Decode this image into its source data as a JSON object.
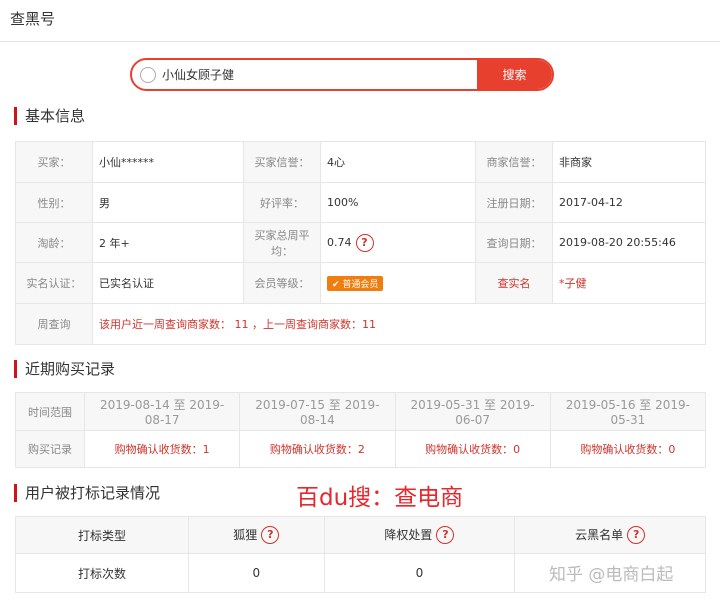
{
  "header": {
    "title": "查黑号"
  },
  "search": {
    "value": "小仙女顾子健",
    "button": "搜索"
  },
  "basic": {
    "title": "基本信息",
    "rows": [
      [
        {
          "l": "买家：",
          "v": "小仙******"
        },
        {
          "l": "买家信誉：",
          "v": "4心"
        },
        {
          "l": "商家信誉：",
          "v": "非商家"
        }
      ],
      [
        {
          "l": "性别：",
          "v": "男"
        },
        {
          "l": "好评率：",
          "v": "100%"
        },
        {
          "l": "注册日期：",
          "v": "2017-04-12"
        }
      ],
      [
        {
          "l": "淘龄：",
          "v": "2 年+"
        },
        {
          "l": "买家总周平均：",
          "v": "0.74"
        },
        {
          "l": "查询日期：",
          "v": "2019-08-20 20:55:46"
        }
      ],
      [
        {
          "l": "实名认证：",
          "v": "已实名认证"
        },
        {
          "l": "会员等级：",
          "v": "普通会员"
        },
        {
          "l": "查实名",
          "v": "*子健"
        }
      ]
    ],
    "weekly_label": "周查询",
    "weekly_value": "该用户近一周查询商家数： 11 ，上一周查询商家数：11"
  },
  "purchase": {
    "title": "近期购买记录",
    "range_label": "时间范围",
    "record_label": "购买记录",
    "ranges": [
      "2019-08-14 至 2019-08-17",
      "2019-07-15 至 2019-08-14",
      "2019-05-31 至 2019-06-07",
      "2019-05-16 至 2019-05-31"
    ],
    "records": [
      "购物确认收货数：1",
      "购物确认收货数：2",
      "购物确认收货数：0",
      "购物确认收货数：0"
    ]
  },
  "marks": {
    "title": "用户被打标记录情况",
    "headers": [
      "打标类型",
      "狐狸",
      "降权处置",
      "云黑名单"
    ],
    "row_label": "打标次数",
    "values": [
      "0",
      "0",
      ""
    ]
  },
  "watermarks": {
    "promo": "百du搜：查电商",
    "zhihu": "知乎 @电商白起"
  }
}
